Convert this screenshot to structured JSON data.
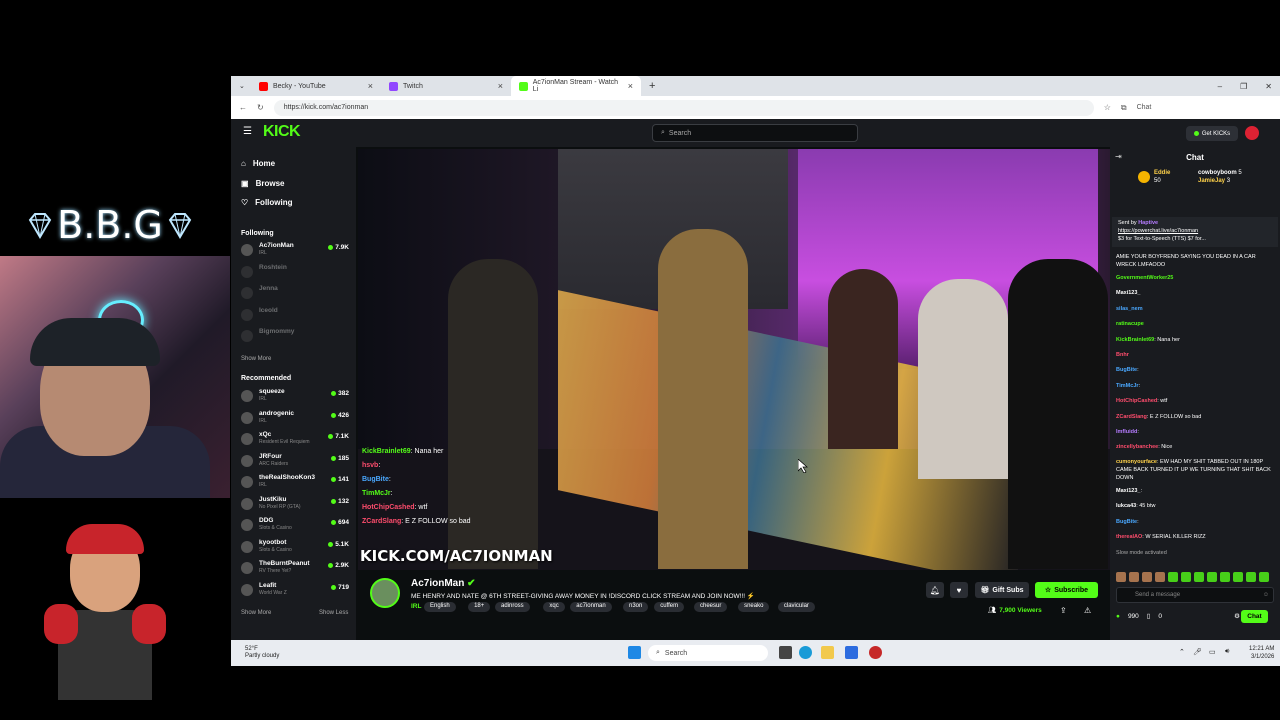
{
  "overlay": {
    "brand": "B.B.G"
  },
  "browser": {
    "tabs": [
      {
        "label": "Becky - YouTube"
      },
      {
        "label": "Twitch"
      },
      {
        "label": "Ac7ionMan Stream - Watch Li"
      }
    ],
    "url": "https://kick.com/ac7ionman",
    "chat_label": "Chat"
  },
  "kick": {
    "logo": "KICK",
    "search_placeholder": "Search",
    "get_kicks": "Get KICKs",
    "nav": {
      "home": "Home",
      "browse": "Browse",
      "following": "Following"
    },
    "following_label": "Following",
    "following": [
      {
        "name": "Ac7ionMan",
        "sub": "IRL",
        "viewers": "7.9K"
      },
      {
        "name": "Roshtein",
        "sub": "",
        "viewers": ""
      },
      {
        "name": "Jenna",
        "sub": "",
        "viewers": ""
      },
      {
        "name": "Iceold",
        "sub": "",
        "viewers": ""
      },
      {
        "name": "Bigmommy",
        "sub": "",
        "viewers": ""
      }
    ],
    "show_more": "Show More",
    "show_less": "Show Less",
    "recommended_label": "Recommended",
    "recommended": [
      {
        "name": "squeeze",
        "sub": "IRL",
        "viewers": "382"
      },
      {
        "name": "androgenic",
        "sub": "IRL",
        "viewers": "426"
      },
      {
        "name": "xQc",
        "sub": "Resident Evil Requiem",
        "viewers": "7.1K"
      },
      {
        "name": "JRFour",
        "sub": "ARC Raiders",
        "viewers": "185"
      },
      {
        "name": "theRealShooKon3",
        "sub": "IRL",
        "viewers": "141"
      },
      {
        "name": "JustKiku",
        "sub": "No Pixel RP (GTA)",
        "viewers": "132"
      },
      {
        "name": "DDG",
        "sub": "Slots & Casino",
        "viewers": "694"
      },
      {
        "name": "kyootbot",
        "sub": "Slots & Casino",
        "viewers": "5.1K"
      },
      {
        "name": "TheBurntPeanut",
        "sub": "RV There Yet?",
        "viewers": "2.9K"
      },
      {
        "name": "Leafit",
        "sub": "World War Z",
        "viewers": "719"
      }
    ],
    "video": {
      "watermark": "KICK.COM/AC7IONMAN",
      "chat_overlay": [
        {
          "user": "KickBrainlet69",
          "text": ": Nana her"
        },
        {
          "user": "hsvb",
          "text": ":"
        },
        {
          "user": "BugBite",
          "text": ":"
        },
        {
          "user": "TimMcJr",
          "text": ":"
        },
        {
          "user": "HotChipCashed",
          "text": ": wtf"
        },
        {
          "user": "ZCardSlang",
          "text": ": E Z FOLLOW so bad"
        }
      ]
    },
    "stream": {
      "name": "Ac7ionMan",
      "title": "ME HENRY AND NATE @ 6TH STREET-GIVING AWAY MONEY IN !DISCORD CLICK STREAM AND JOIN NOW!!! ⚡",
      "category": "IRL",
      "tags": [
        "English",
        "18+",
        "adinross",
        "xqc",
        "ac7ionman",
        "n3on",
        "cuffem",
        "cheesur",
        "sneako",
        "clavicular"
      ],
      "gift_subs": "Gift Subs",
      "subscribe": "Subscribe",
      "viewers": "7,900 Viewers"
    },
    "chat": {
      "title": "Chat",
      "pinned": [
        {
          "user": "Eddie",
          "amount": "50"
        },
        {
          "user": "cowboyboom",
          "amount": "5"
        },
        {
          "user": "JamieJay",
          "amount": "3"
        }
      ],
      "tts": {
        "sender": "Sent by",
        "user": "Haptive",
        "link": "https://powerchat.live/ac7ionman",
        "text": "$3 for Text-to-Speech (TTS) $7 for..."
      },
      "messages": [
        {
          "user": "",
          "text": "AMIE YOUR BOYFREND SAYING YOU DEAD IN A CAR WRECK LMFAOOO",
          "wrap": true,
          "color": "#ffffff"
        },
        {
          "user": "GovernmentWorker25",
          "text": "",
          "color": "#53fc18"
        },
        {
          "user": "Maxi123_",
          "text": "",
          "color": "#ffffff"
        },
        {
          "user": "silas_nem",
          "text": "",
          "color": "#4aa8ff"
        },
        {
          "user": "ratinacupe",
          "text": "",
          "color": "#53fc18"
        },
        {
          "user": "KickBrainlet69",
          "text": ": Nana her",
          "color": "#53fc18"
        },
        {
          "user": "Bnhr",
          "text": "",
          "color": "#ff4d6d"
        },
        {
          "user": "BugBite",
          "text": ":",
          "color": "#4aa8ff"
        },
        {
          "user": "TimMcJr",
          "text": ":",
          "color": "#4aa8ff"
        },
        {
          "user": "HotChipCashed",
          "text": ": wtf",
          "color": "#ff4d6d"
        },
        {
          "user": "ZCardSlang",
          "text": ": E Z FOLLOW so bad",
          "color": "#ff4d6d"
        },
        {
          "user": "Imfluidd",
          "text": ":",
          "color": "#b57cff"
        },
        {
          "user": "zincellybanchee",
          "text": ": Nice",
          "color": "#ff4d6d"
        },
        {
          "user": "cumonyourface",
          "text": ": EW HAD MY SHIT TABBED OUT IN 180P CAME BACK TURNED IT UP WE TURNING THAT SHIT BACK DOWN",
          "wrap": true,
          "color": "#ffd24a"
        },
        {
          "user": "Maxi123_",
          "text": ":",
          "color": "#ffffff"
        },
        {
          "user": "lukca43",
          "text": ": 45 btw",
          "color": "#ffffff"
        },
        {
          "user": "BugBite",
          "text": ":",
          "color": "#4aa8ff"
        },
        {
          "user": "therealAO",
          "text": ": W SERIAL KILLER RIZZ",
          "color": "#ff4d6d"
        },
        {
          "user": "",
          "text": "Slow mode activated",
          "color": "#aaaaaa"
        }
      ],
      "input_placeholder": "Send a message",
      "kicks": "990",
      "gift_count": "0",
      "send": "Chat"
    }
  },
  "taskbar": {
    "weather_temp": "52°F",
    "weather_desc": "Partly cloudy",
    "search": "Search",
    "time": "12:21 AM",
    "date": "3/1/2026"
  }
}
